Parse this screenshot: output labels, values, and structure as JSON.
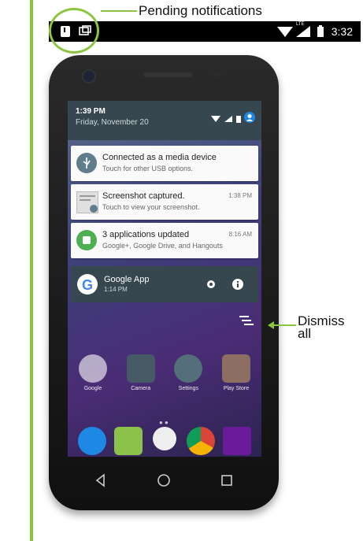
{
  "callouts": {
    "pending": "Pending notifications",
    "dismiss_line1": "Dismiss",
    "dismiss_line2": "all"
  },
  "status_bar": {
    "time": "3:32",
    "network": "LTE"
  },
  "shade": {
    "time": "1:39 PM",
    "date": "Friday, November 20"
  },
  "notifications": [
    {
      "title": "Connected as a media device",
      "subtitle": "Touch for other USB options.",
      "time": "",
      "icon": "usb-icon",
      "color": "#607d8b"
    },
    {
      "title": "Screenshot captured.",
      "subtitle": "Touch to view your screenshot.",
      "time": "1:38 PM",
      "icon": "screenshot-thumb",
      "color": "#9e9e9e"
    },
    {
      "title": "3 applications updated",
      "subtitle": "Google+, Google Drive, and Hangouts",
      "time": "8:16 AM",
      "icon": "play-store-update-icon",
      "color": "#4caf50"
    }
  ],
  "google_app": {
    "title": "Google App",
    "time": "1:14 PM"
  },
  "apps_row1": [
    "Google",
    "Camera",
    "Settings",
    "Play Store"
  ],
  "accent": "#8cc63f"
}
